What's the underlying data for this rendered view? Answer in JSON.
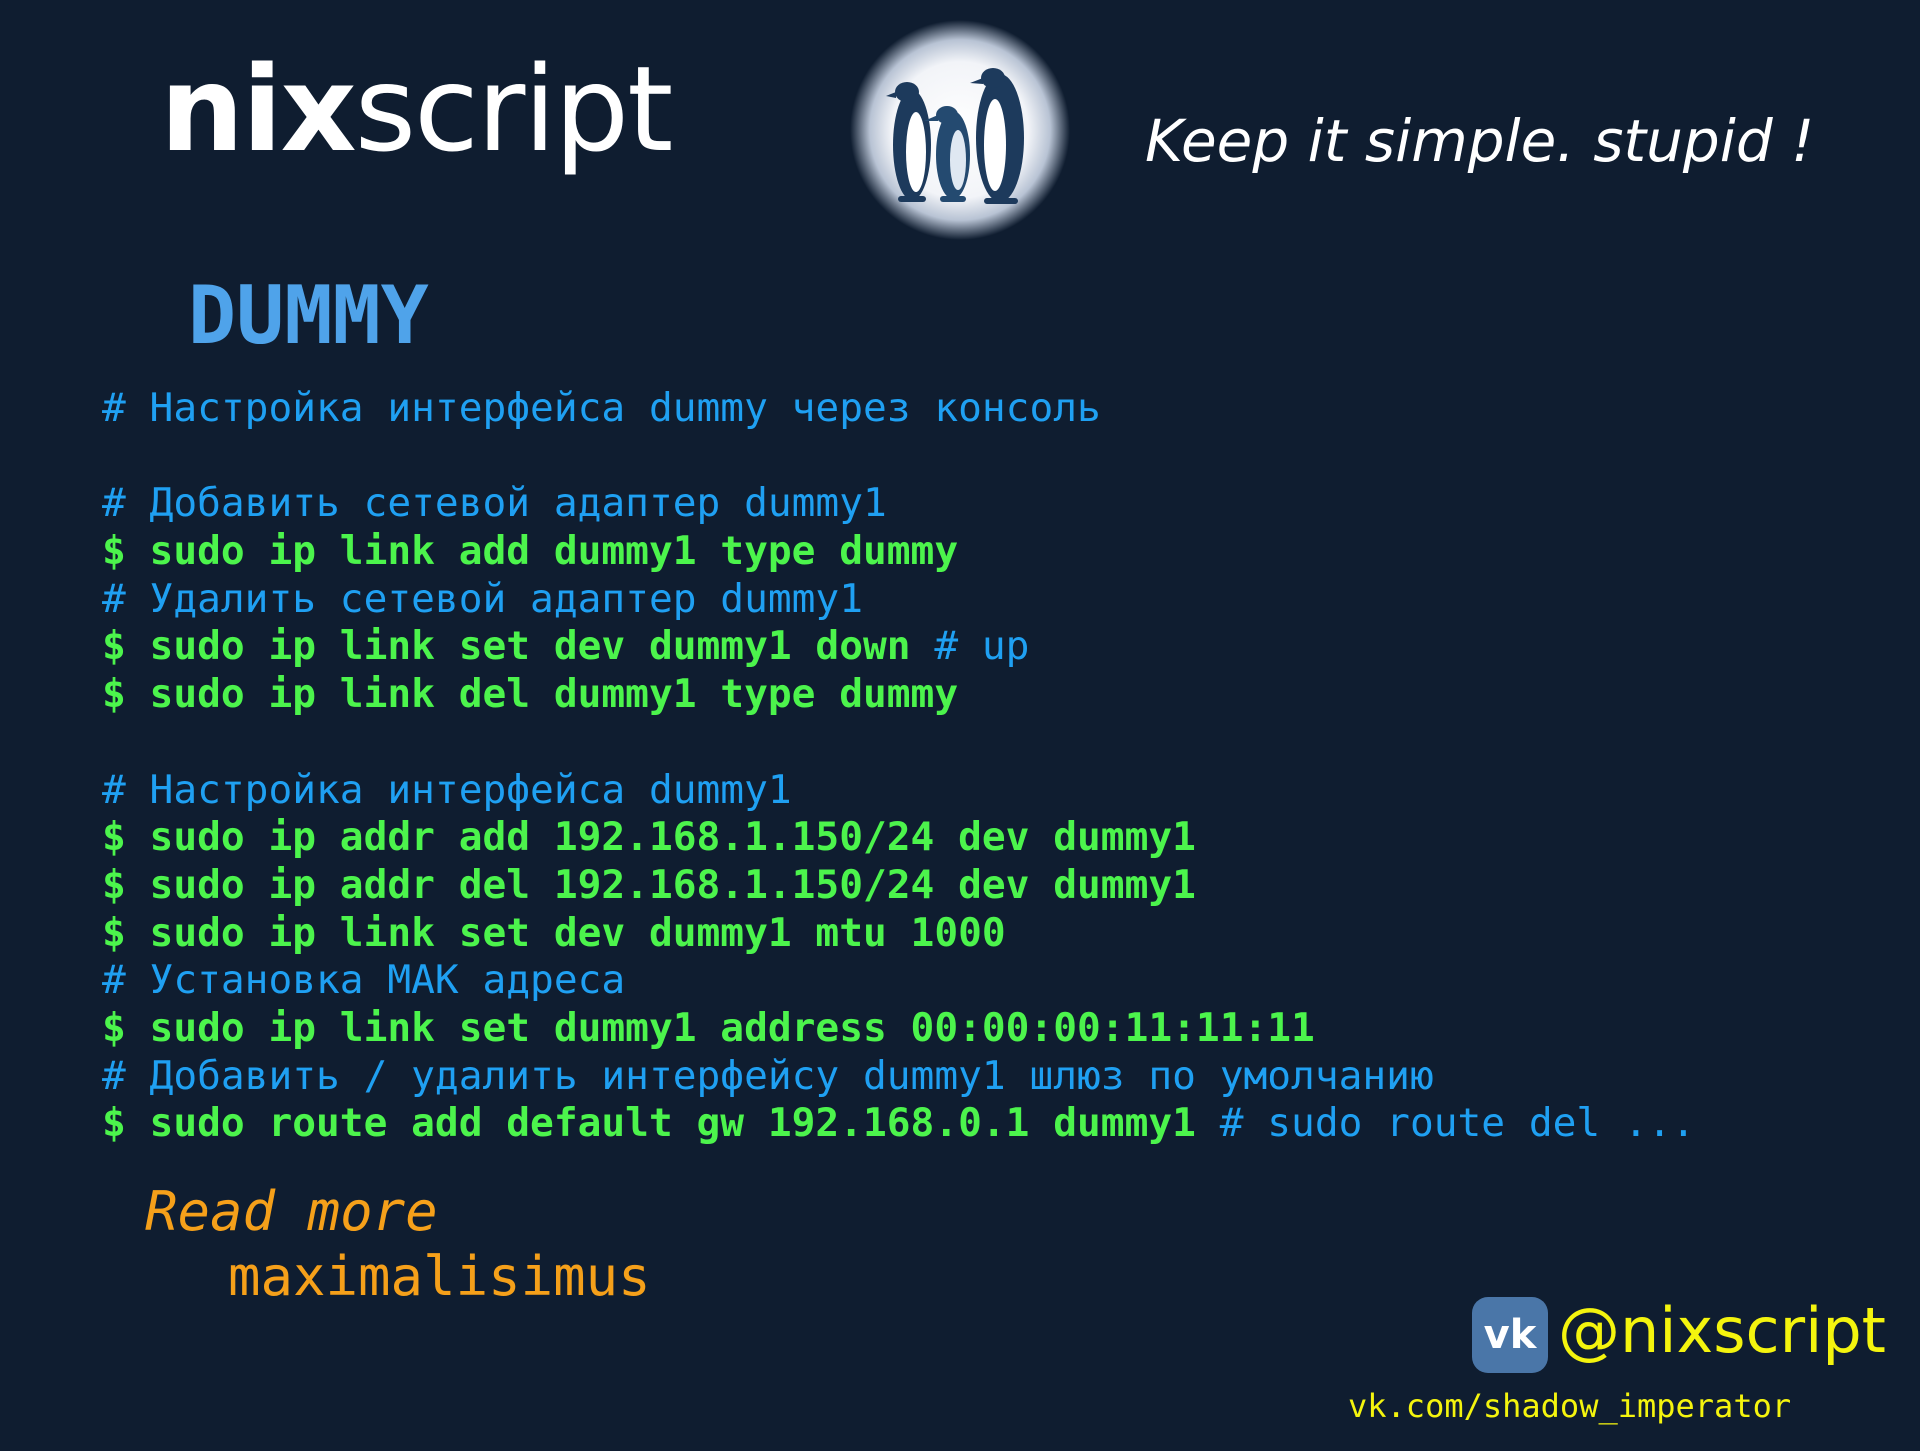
{
  "header": {
    "logo_bold": "nix",
    "logo_light": "script",
    "mascot_icon": "penguins-icon",
    "tagline": "Keep it simple. stupid !"
  },
  "title": "DUMMY",
  "code_lines": [
    [
      {
        "t": "# Настройка интерфейса dummy через консоль",
        "k": "comment"
      }
    ],
    [],
    [
      {
        "t": "# Добавить сетевой адаптер dummy1",
        "k": "comment"
      }
    ],
    [
      {
        "t": "$ sudo ip link add dummy1 type dummy",
        "k": "cmd"
      }
    ],
    [
      {
        "t": "# Удалить сетевой адаптер dummy1",
        "k": "comment"
      }
    ],
    [
      {
        "t": "$ sudo ip link set dev dummy1 down ",
        "k": "cmd"
      },
      {
        "t": "# up",
        "k": "comment"
      }
    ],
    [
      {
        "t": "$ sudo ip link del dummy1 type dummy",
        "k": "cmd"
      }
    ],
    [],
    [
      {
        "t": "# Настройка интерфейса dummy1",
        "k": "comment"
      }
    ],
    [
      {
        "t": "$ sudo ip addr add 192.168.1.150/24 dev dummy1",
        "k": "cmd"
      }
    ],
    [
      {
        "t": "$ sudo ip addr del 192.168.1.150/24 dev dummy1",
        "k": "cmd"
      }
    ],
    [
      {
        "t": "$ sudo ip link set dev dummy1 mtu 1000",
        "k": "cmd"
      }
    ],
    [
      {
        "t": "# Установка MAK адреса",
        "k": "comment"
      }
    ],
    [
      {
        "t": "$ sudo ip link set dummy1 address 00:00:00:11:11:11",
        "k": "cmd"
      }
    ],
    [
      {
        "t": "# Добавить / удалить интерфейсу dummy1 шлюз по умолчанию",
        "k": "comment"
      }
    ],
    [
      {
        "t": "$ sudo route add default gw 192.168.0.1 dummy1 ",
        "k": "cmd"
      },
      {
        "t": "# sudo route del ...",
        "k": "comment"
      }
    ]
  ],
  "footer": {
    "read_more": "Read more",
    "author": "maximalisimus",
    "vk_icon": "vk-logo-icon",
    "vk_badge": "vk",
    "handle": "@nixscript",
    "url": "vk.com/shadow_imperator"
  },
  "colors": {
    "background": "#0f1d30",
    "title": "#4fa3ea",
    "comment": "#1fa0f2",
    "command": "#4cf44c",
    "read_more": "#f5a01a",
    "handle": "#f4f40e",
    "vk_blue": "#4a76a8"
  }
}
